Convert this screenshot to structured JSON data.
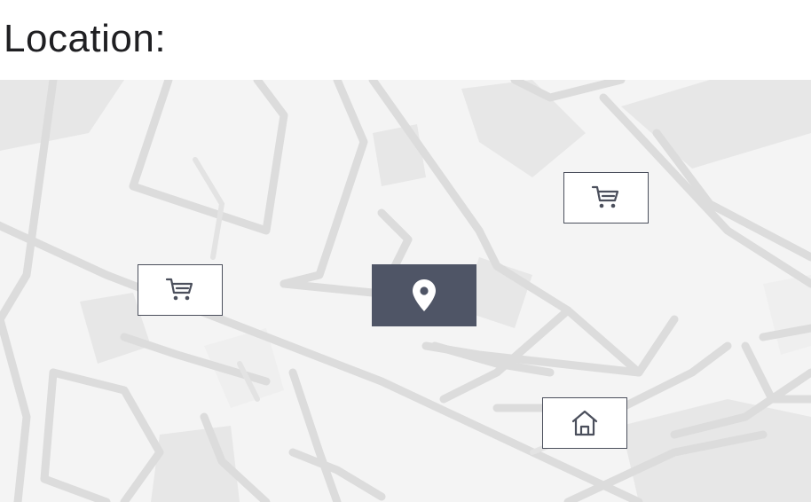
{
  "page": {
    "title": "Location:"
  },
  "map": {
    "colors": {
      "background": "#f4f4f4",
      "road": "#dadada",
      "block": "#e6e6e6",
      "marker_border": "#4b4f5c",
      "current_location_fill": "#4f5566"
    },
    "markers": [
      {
        "type": "shopping-cart",
        "icon": "cart-icon"
      },
      {
        "type": "shopping-cart",
        "icon": "cart-icon"
      },
      {
        "type": "current-location",
        "icon": "location-pin-icon"
      },
      {
        "type": "home",
        "icon": "home-icon"
      }
    ]
  }
}
